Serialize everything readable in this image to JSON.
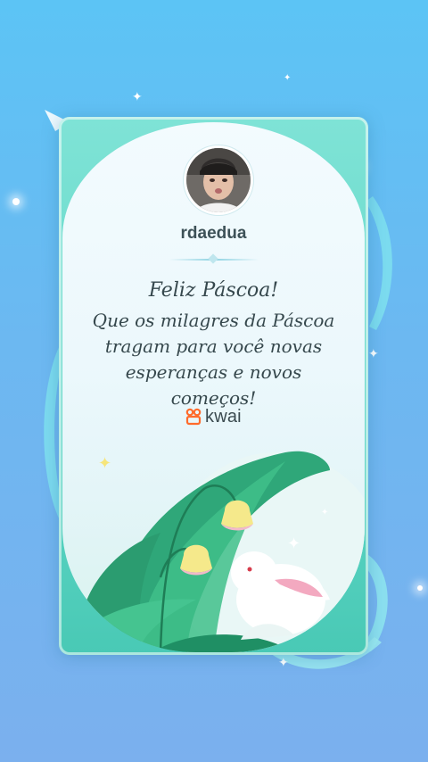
{
  "card": {
    "username": "rdaedua",
    "title": "Feliz Páscoa!",
    "message": "Que os milagres da Páscoa tragam para você novas esperanças e novos começos!",
    "brand": "kwai"
  },
  "colors": {
    "background_top": "#5cc4f5",
    "background_bottom": "#7bb0ee",
    "card_frame": "#5fd6c6",
    "brand_logo": "#ff6b2c",
    "text": "#36484d"
  },
  "icons": [
    "sparkle-icon",
    "kwai-logo-icon",
    "avatar",
    "bunny-illustration",
    "bell-flower-illustration"
  ]
}
